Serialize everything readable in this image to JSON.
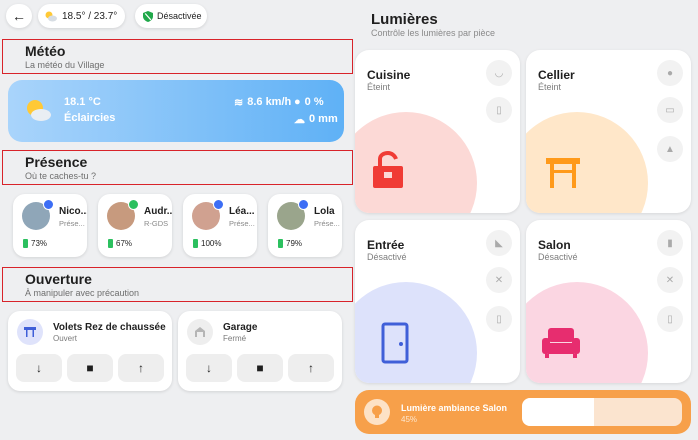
{
  "topbar": {
    "weather": "18.5° / 23.7°",
    "alarm": "Désactivée"
  },
  "sections": {
    "meteo": {
      "title": "Météo",
      "subtitle": "La météo du Village"
    },
    "presence": {
      "title": "Présence",
      "subtitle": "Où te caches-tu ?"
    },
    "ouverture": {
      "title": "Ouverture",
      "subtitle": "À manipuler avec précaution"
    }
  },
  "weather": {
    "temperature": "18.1 °C",
    "condition": "Éclaircies",
    "wind": "8.6 km/h",
    "humidity": "0 %",
    "rain": "0 mm"
  },
  "people": [
    {
      "name": "Nico...",
      "status": "Prése...",
      "battery": "73%",
      "badge_color": "#3d6ef5"
    },
    {
      "name": "Audr...",
      "status": "R-GDS",
      "battery": "67%",
      "badge_color": "#2cc05f"
    },
    {
      "name": "Léa...",
      "status": "Prése...",
      "battery": "100%",
      "badge_color": "#3d6ef5"
    },
    {
      "name": "Lola",
      "status": "Prése...",
      "battery": "79%",
      "badge_color": "#3d6ef5"
    }
  ],
  "covers": [
    {
      "name": "Volets Rez de chaussée",
      "state": "Ouvert"
    },
    {
      "name": "Garage",
      "state": "Fermé"
    }
  ],
  "lights": {
    "title": "Lumières",
    "subtitle": "Contrôle les lumières par pièce",
    "rooms": [
      {
        "name": "Cuisine",
        "state": "Éteint",
        "color": "#f03b35",
        "blob": "#fcd9d6"
      },
      {
        "name": "Cellier",
        "state": "Éteint",
        "color": "#ff9a1a",
        "blob": "#ffe7c9"
      },
      {
        "name": "Entrée",
        "state": "Désactivé",
        "color": "#3f5fd8",
        "blob": "#dde2fb"
      },
      {
        "name": "Salon",
        "state": "Désactivé",
        "color": "#e72d6f",
        "blob": "#fbd6e2"
      }
    ],
    "ambiance": {
      "name": "Lumière ambiance Salon",
      "value": "45%",
      "level": 0.45
    }
  }
}
